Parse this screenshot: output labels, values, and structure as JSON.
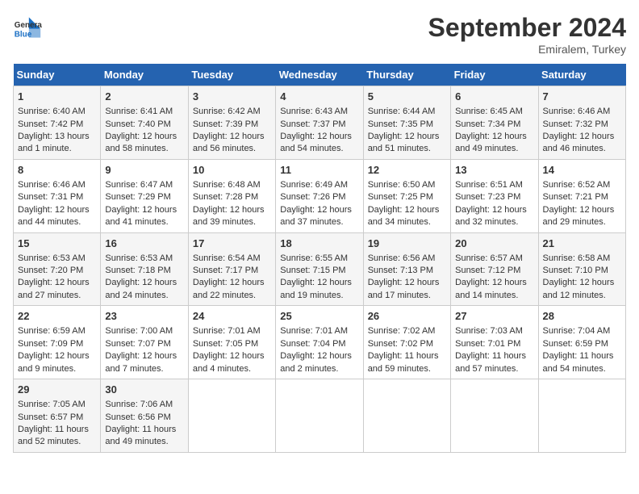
{
  "header": {
    "logo_line1": "General",
    "logo_line2": "Blue",
    "month": "September 2024",
    "location": "Emiralem, Turkey"
  },
  "days_of_week": [
    "Sunday",
    "Monday",
    "Tuesday",
    "Wednesday",
    "Thursday",
    "Friday",
    "Saturday"
  ],
  "weeks": [
    [
      {
        "day": "1",
        "sunrise": "6:40 AM",
        "sunset": "7:42 PM",
        "daylight": "Daylight: 13 hours and 1 minute."
      },
      {
        "day": "2",
        "sunrise": "6:41 AM",
        "sunset": "7:40 PM",
        "daylight": "Daylight: 12 hours and 58 minutes."
      },
      {
        "day": "3",
        "sunrise": "6:42 AM",
        "sunset": "7:39 PM",
        "daylight": "Daylight: 12 hours and 56 minutes."
      },
      {
        "day": "4",
        "sunrise": "6:43 AM",
        "sunset": "7:37 PM",
        "daylight": "Daylight: 12 hours and 54 minutes."
      },
      {
        "day": "5",
        "sunrise": "6:44 AM",
        "sunset": "7:35 PM",
        "daylight": "Daylight: 12 hours and 51 minutes."
      },
      {
        "day": "6",
        "sunrise": "6:45 AM",
        "sunset": "7:34 PM",
        "daylight": "Daylight: 12 hours and 49 minutes."
      },
      {
        "day": "7",
        "sunrise": "6:46 AM",
        "sunset": "7:32 PM",
        "daylight": "Daylight: 12 hours and 46 minutes."
      }
    ],
    [
      {
        "day": "8",
        "sunrise": "6:46 AM",
        "sunset": "7:31 PM",
        "daylight": "Daylight: 12 hours and 44 minutes."
      },
      {
        "day": "9",
        "sunrise": "6:47 AM",
        "sunset": "7:29 PM",
        "daylight": "Daylight: 12 hours and 41 minutes."
      },
      {
        "day": "10",
        "sunrise": "6:48 AM",
        "sunset": "7:28 PM",
        "daylight": "Daylight: 12 hours and 39 minutes."
      },
      {
        "day": "11",
        "sunrise": "6:49 AM",
        "sunset": "7:26 PM",
        "daylight": "Daylight: 12 hours and 37 minutes."
      },
      {
        "day": "12",
        "sunrise": "6:50 AM",
        "sunset": "7:25 PM",
        "daylight": "Daylight: 12 hours and 34 minutes."
      },
      {
        "day": "13",
        "sunrise": "6:51 AM",
        "sunset": "7:23 PM",
        "daylight": "Daylight: 12 hours and 32 minutes."
      },
      {
        "day": "14",
        "sunrise": "6:52 AM",
        "sunset": "7:21 PM",
        "daylight": "Daylight: 12 hours and 29 minutes."
      }
    ],
    [
      {
        "day": "15",
        "sunrise": "6:53 AM",
        "sunset": "7:20 PM",
        "daylight": "Daylight: 12 hours and 27 minutes."
      },
      {
        "day": "16",
        "sunrise": "6:53 AM",
        "sunset": "7:18 PM",
        "daylight": "Daylight: 12 hours and 24 minutes."
      },
      {
        "day": "17",
        "sunrise": "6:54 AM",
        "sunset": "7:17 PM",
        "daylight": "Daylight: 12 hours and 22 minutes."
      },
      {
        "day": "18",
        "sunrise": "6:55 AM",
        "sunset": "7:15 PM",
        "daylight": "Daylight: 12 hours and 19 minutes."
      },
      {
        "day": "19",
        "sunrise": "6:56 AM",
        "sunset": "7:13 PM",
        "daylight": "Daylight: 12 hours and 17 minutes."
      },
      {
        "day": "20",
        "sunrise": "6:57 AM",
        "sunset": "7:12 PM",
        "daylight": "Daylight: 12 hours and 14 minutes."
      },
      {
        "day": "21",
        "sunrise": "6:58 AM",
        "sunset": "7:10 PM",
        "daylight": "Daylight: 12 hours and 12 minutes."
      }
    ],
    [
      {
        "day": "22",
        "sunrise": "6:59 AM",
        "sunset": "7:09 PM",
        "daylight": "Daylight: 12 hours and 9 minutes."
      },
      {
        "day": "23",
        "sunrise": "7:00 AM",
        "sunset": "7:07 PM",
        "daylight": "Daylight: 12 hours and 7 minutes."
      },
      {
        "day": "24",
        "sunrise": "7:01 AM",
        "sunset": "7:05 PM",
        "daylight": "Daylight: 12 hours and 4 minutes."
      },
      {
        "day": "25",
        "sunrise": "7:01 AM",
        "sunset": "7:04 PM",
        "daylight": "Daylight: 12 hours and 2 minutes."
      },
      {
        "day": "26",
        "sunrise": "7:02 AM",
        "sunset": "7:02 PM",
        "daylight": "Daylight: 11 hours and 59 minutes."
      },
      {
        "day": "27",
        "sunrise": "7:03 AM",
        "sunset": "7:01 PM",
        "daylight": "Daylight: 11 hours and 57 minutes."
      },
      {
        "day": "28",
        "sunrise": "7:04 AM",
        "sunset": "6:59 PM",
        "daylight": "Daylight: 11 hours and 54 minutes."
      }
    ],
    [
      {
        "day": "29",
        "sunrise": "7:05 AM",
        "sunset": "6:57 PM",
        "daylight": "Daylight: 11 hours and 52 minutes."
      },
      {
        "day": "30",
        "sunrise": "7:06 AM",
        "sunset": "6:56 PM",
        "daylight": "Daylight: 11 hours and 49 minutes."
      },
      null,
      null,
      null,
      null,
      null
    ]
  ]
}
